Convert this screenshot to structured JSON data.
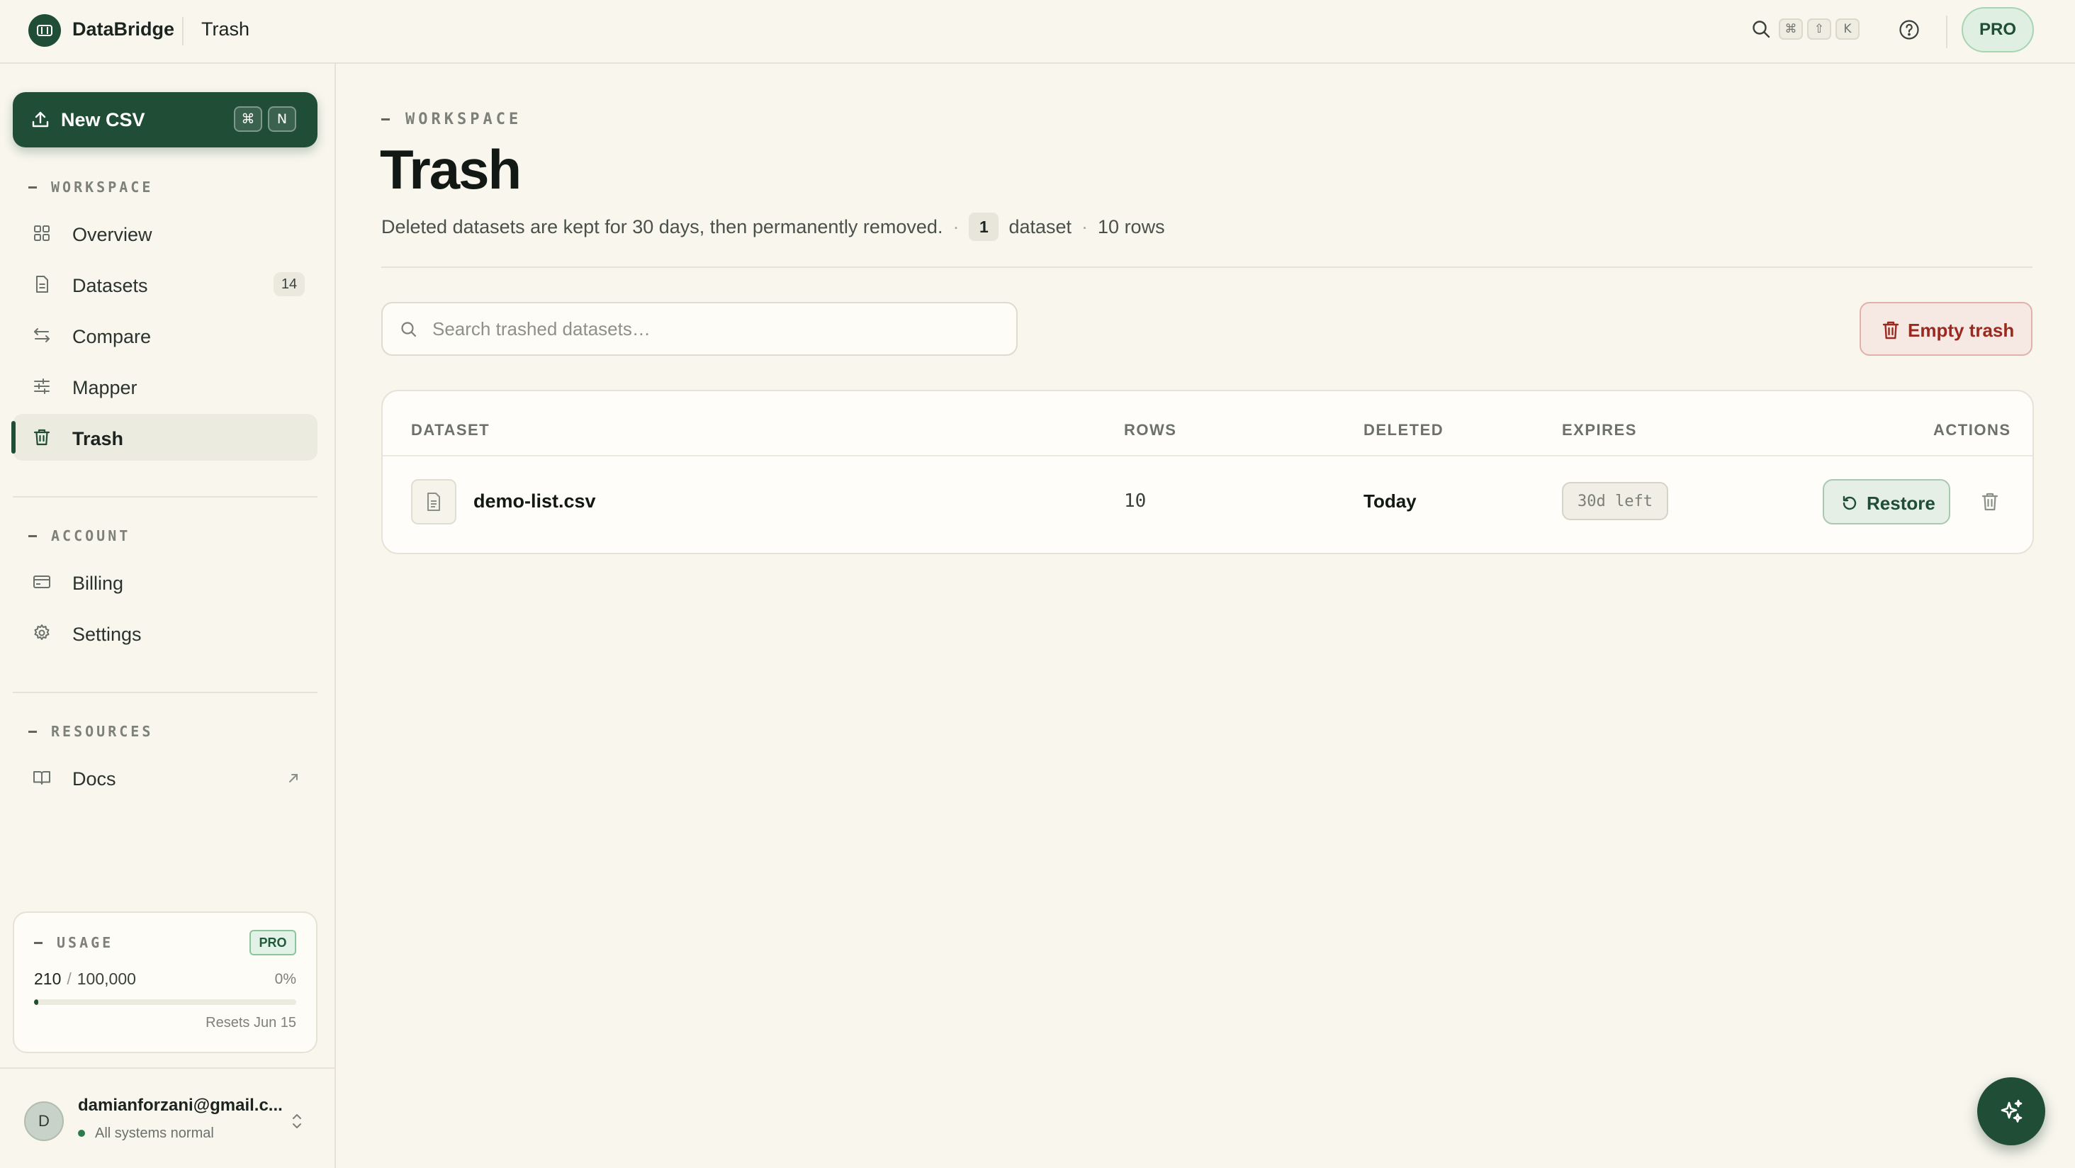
{
  "app": {
    "name": "DataBridge"
  },
  "topbar": {
    "breadcrumb": "Trash",
    "shortcut_keys": [
      "⌘",
      "⇧",
      "K"
    ],
    "plan_badge": "PRO"
  },
  "sidebar": {
    "new_button": {
      "label": "New CSV",
      "keys": [
        "⌘",
        "N"
      ]
    },
    "sections": {
      "workspace": "WORKSPACE",
      "account": "ACCOUNT",
      "resources": "RESOURCES"
    },
    "items": {
      "overview": {
        "label": "Overview",
        "icon": "grid-icon"
      },
      "datasets": {
        "label": "Datasets",
        "icon": "file-icon",
        "count": "14"
      },
      "compare": {
        "label": "Compare",
        "icon": "arrows-swap-icon"
      },
      "mapper": {
        "label": "Mapper",
        "icon": "sliders-icon"
      },
      "trash": {
        "label": "Trash",
        "icon": "trash-icon",
        "active": true
      },
      "billing": {
        "label": "Billing",
        "icon": "credit-card-icon"
      },
      "settings": {
        "label": "Settings",
        "icon": "gear-icon"
      },
      "docs": {
        "label": "Docs",
        "icon": "book-icon"
      }
    },
    "usage": {
      "label": "USAGE",
      "plan": "PRO",
      "used": "210",
      "total": "100,000",
      "percent_label": "0%",
      "fraction_used": 0.0021,
      "reset": "Resets Jun 15"
    },
    "user": {
      "initial": "D",
      "email": "damianforzani@gmail.c...",
      "status": "All systems normal"
    }
  },
  "main": {
    "eyebrow": "WORKSPACE",
    "title": "Trash",
    "description": "Deleted datasets are kept for 30 days, then permanently removed.",
    "dataset_count": "1",
    "dataset_word": "dataset",
    "rows_summary": "10 rows",
    "search_placeholder": "Search trashed datasets…",
    "empty_button": "Empty trash",
    "table": {
      "columns": [
        "DATASET",
        "ROWS",
        "DELETED",
        "EXPIRES",
        "ACTIONS"
      ],
      "rows": [
        {
          "name": "demo-list.csv",
          "rows": "10",
          "deleted": "Today",
          "expires": "30d left",
          "restore_label": "Restore"
        }
      ]
    }
  },
  "colors": {
    "brand": "#1f4d36",
    "background": "#f8f6ed",
    "danger": "#9a2a20"
  }
}
